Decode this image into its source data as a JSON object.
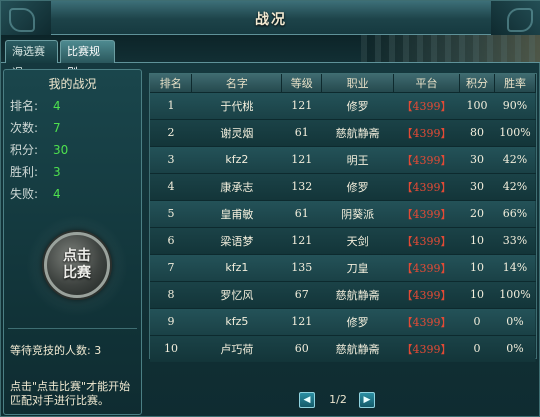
{
  "window": {
    "title": "战况"
  },
  "tabs": [
    {
      "label": "海选赛况",
      "selected": false
    },
    {
      "label": "比赛规则",
      "selected": true
    }
  ],
  "stats": {
    "title": "我的战况",
    "rank_label": "排名:",
    "rank": "4",
    "count_label": "次数:",
    "count": "7",
    "points_label": "积分:",
    "points": "30",
    "wins_label": "胜利:",
    "wins": "3",
    "losses_label": "失败:",
    "losses": "4",
    "value_color": "#4ee04e"
  },
  "start_button": {
    "line1": "点击",
    "line2": "比赛"
  },
  "waiting": "等待竞技的人数: 3",
  "hint": "点击\"点击比赛\"才能开始匹配对手进行比赛。",
  "table": {
    "headers": [
      "排名",
      "名字",
      "等级",
      "职业",
      "平台",
      "积分",
      "胜率"
    ],
    "rows": [
      [
        "1",
        "于代桃",
        "121",
        "修罗",
        "【4399】",
        "100",
        "90%"
      ],
      [
        "2",
        "谢灵烟",
        "61",
        "慈航静斋",
        "【4399】",
        "80",
        "100%"
      ],
      [
        "3",
        "kfz2",
        "121",
        "明王",
        "【4399】",
        "30",
        "42%"
      ],
      [
        "4",
        "康承志",
        "132",
        "修罗",
        "【4399】",
        "30",
        "42%"
      ],
      [
        "5",
        "皇甫敏",
        "61",
        "阴葵派",
        "【4399】",
        "20",
        "66%"
      ],
      [
        "6",
        "梁语梦",
        "121",
        "天剑",
        "【4399】",
        "10",
        "33%"
      ],
      [
        "7",
        "kfz1",
        "135",
        "刀皇",
        "【4399】",
        "10",
        "14%"
      ],
      [
        "8",
        "罗忆风",
        "67",
        "慈航静斋",
        "【4399】",
        "10",
        "100%"
      ],
      [
        "9",
        "kfz5",
        "121",
        "修罗",
        "【4399】",
        "0",
        "0%"
      ],
      [
        "10",
        "卢巧荷",
        "60",
        "慈航静斋",
        "【4399】",
        "0",
        "0%"
      ]
    ],
    "platform_color": "#e34a35"
  },
  "pager": {
    "label": "1/2",
    "prev_icon": "◀",
    "next_icon": "▶"
  }
}
